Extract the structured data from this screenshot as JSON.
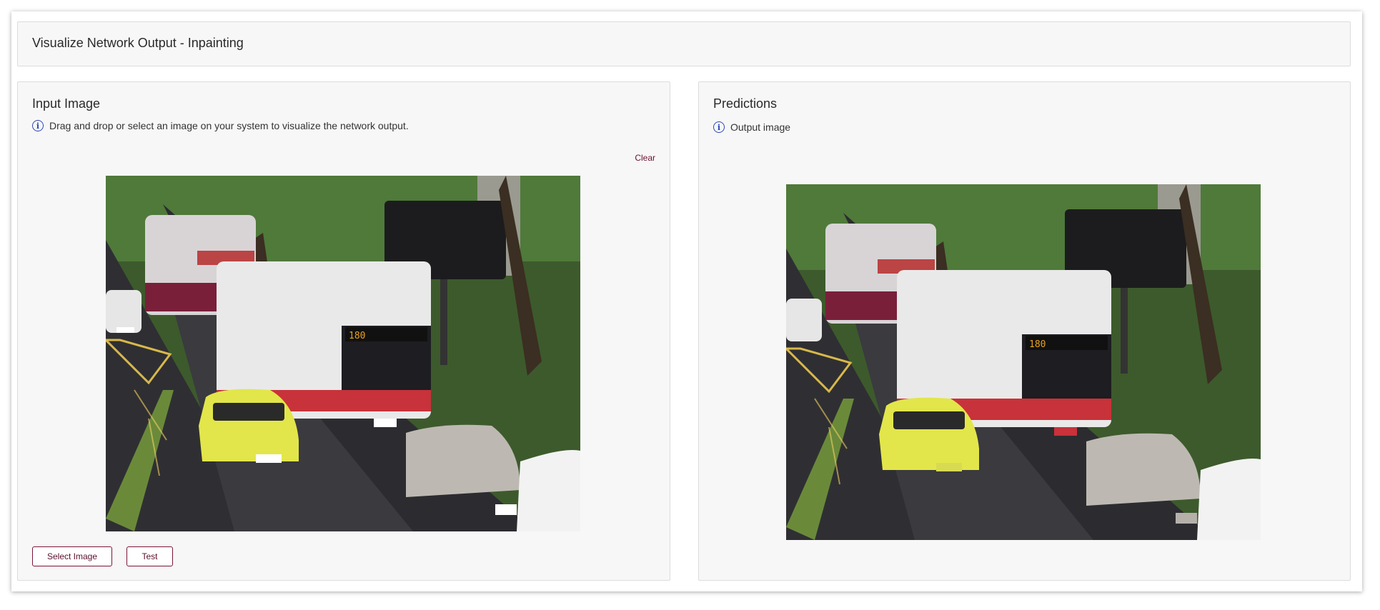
{
  "header": {
    "title": "Visualize Network Output - Inpainting"
  },
  "input_panel": {
    "title": "Input Image",
    "info_text": "Drag and drop or select an image on your system to visualize the network output.",
    "clear_label": "Clear",
    "select_label": "Select Image",
    "test_label": "Test"
  },
  "output_panel": {
    "title": "Predictions",
    "info_text": "Output image"
  },
  "icons": {
    "info": "info-icon"
  },
  "colors": {
    "accent": "#6b1032",
    "info": "#2b46b8"
  }
}
